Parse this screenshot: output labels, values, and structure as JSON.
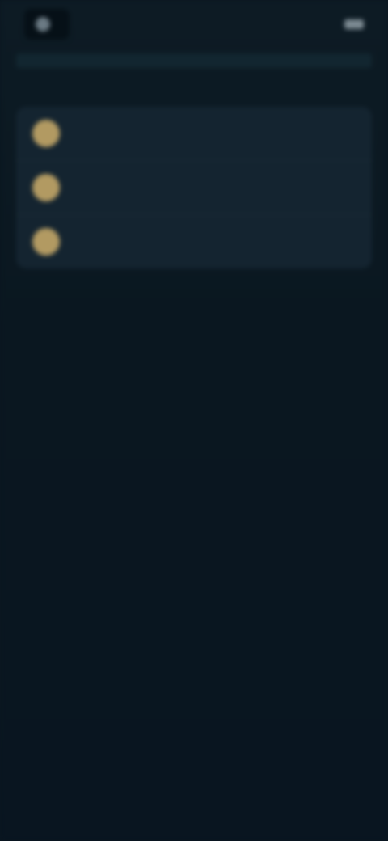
{
  "status": {
    "left_text": "",
    "right_text": ""
  },
  "address": "",
  "title": "",
  "list": {
    "items": [
      {
        "label": ""
      },
      {
        "label": ""
      },
      {
        "label": ""
      }
    ]
  }
}
